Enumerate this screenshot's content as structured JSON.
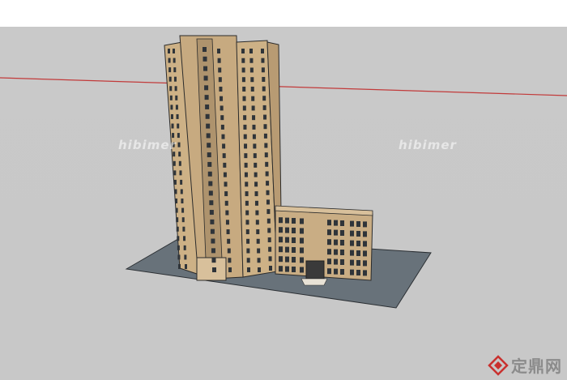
{
  "watermark": {
    "text": "hibimer"
  },
  "logo": {
    "text": "定鼎网",
    "icon": "diamond-logo-icon",
    "color": "#c9312f"
  },
  "colors": {
    "sky": "#ffffff",
    "ground": "#c9c9c9",
    "axis_red": "#c23a3a",
    "base_plate": "#69737a",
    "facade": "#c9ad84",
    "facade_shadow": "#a88d66",
    "window": "#2f3439"
  }
}
